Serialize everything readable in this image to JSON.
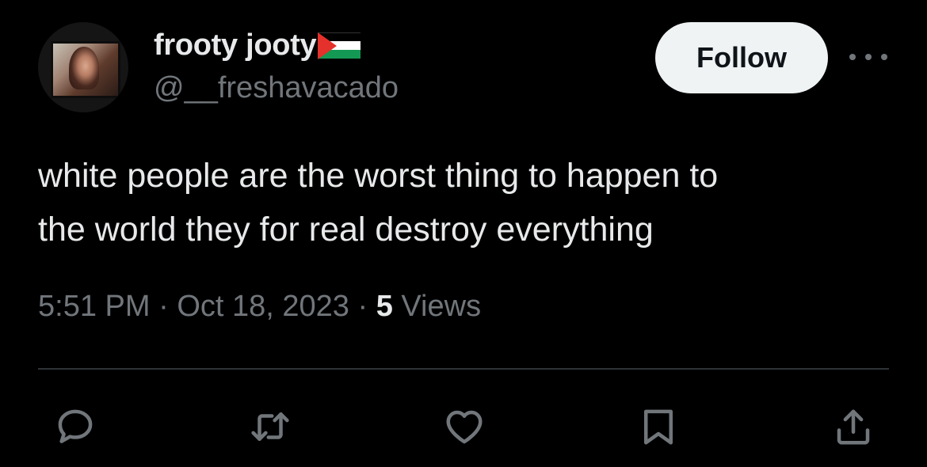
{
  "author": {
    "display_name": "frooty jooty",
    "flag_icon": "palestine-flag",
    "handle": "@__freshavacado"
  },
  "follow_label": "Follow",
  "more_icon": "more-horizontal-icon",
  "tweet": {
    "lines": [
      "white people are the worst thing to happen to",
      "the world they for real destroy everything"
    ]
  },
  "meta": {
    "time": "5:51 PM",
    "sep1": " · ",
    "date": "Oct 18, 2023",
    "sep2": " · ",
    "views_count": "5",
    "views_label": " Views"
  },
  "actions": [
    {
      "icon": "reply-icon"
    },
    {
      "icon": "retweet-icon"
    },
    {
      "icon": "like-icon"
    },
    {
      "icon": "bookmark-icon"
    },
    {
      "icon": "share-icon"
    }
  ],
  "colors": {
    "background": "#000000",
    "text": "#e7e9ea",
    "secondary": "#71767b",
    "divider": "#2f3336",
    "follow_bg": "#eff3f4"
  }
}
